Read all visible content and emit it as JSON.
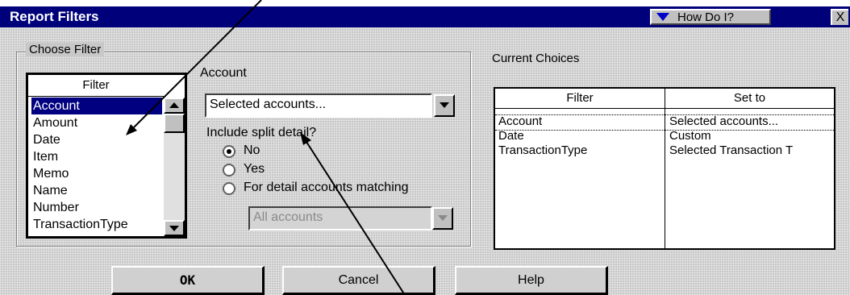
{
  "dialog": {
    "title": "Report Filters",
    "how_do_i": "How Do I?",
    "close": "X"
  },
  "choose_filter": {
    "group_label": "Choose Filter",
    "list_header": "Filter",
    "items": [
      "Account",
      "Amount",
      "Date",
      "Item",
      "Memo",
      "Name",
      "Number",
      "TransactionType"
    ],
    "selected_index": 0
  },
  "account_panel": {
    "label": "Account",
    "combo_value": "Selected accounts...",
    "split_question": "Include split detail?",
    "radios": [
      {
        "label": "No",
        "checked": true
      },
      {
        "label": "Yes",
        "checked": false
      },
      {
        "label": "For detail accounts matching",
        "checked": false
      }
    ],
    "matching_value": "All accounts"
  },
  "current_choices": {
    "label": "Current Choices",
    "headers": [
      "Filter",
      "Set to"
    ],
    "rows": [
      {
        "filter": "Account",
        "set_to": "Selected accounts..."
      },
      {
        "filter": "Date",
        "set_to": "Custom"
      },
      {
        "filter": "TransactionType",
        "set_to": "Selected Transaction T"
      }
    ]
  },
  "buttons": {
    "ok": "OK",
    "cancel": "Cancel",
    "help": "Help"
  }
}
